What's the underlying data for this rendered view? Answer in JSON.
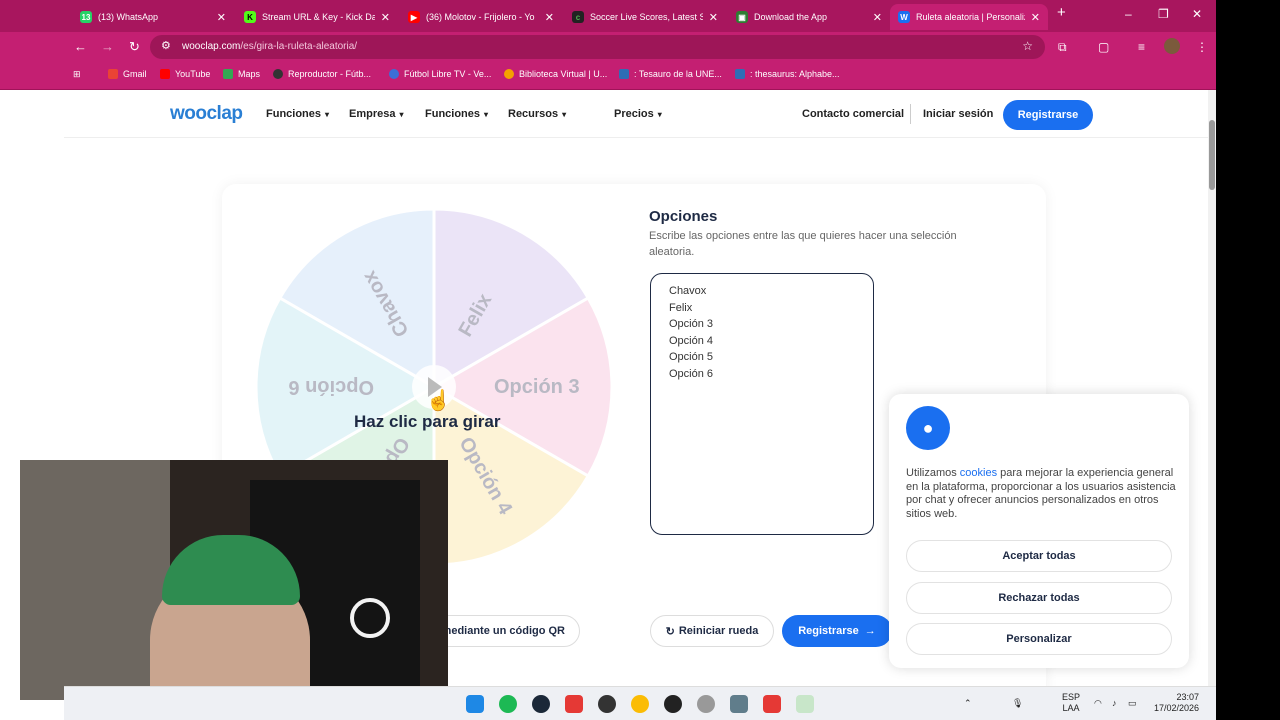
{
  "tabs": [
    {
      "label": "(13) WhatsApp",
      "color": "#25d366",
      "glyph": "13"
    },
    {
      "label": "Stream URL & Key - Kick Da",
      "color": "#53fc18",
      "glyph": "K"
    },
    {
      "label": "(36) Molotov - Frijolero - Yo",
      "color": "#ff0000",
      "glyph": "▶"
    },
    {
      "label": "Soccer Live Scores, Latest S",
      "color": "#222222",
      "glyph": "c"
    },
    {
      "label": "Download the App",
      "color": "#2e7d32",
      "glyph": "▣"
    },
    {
      "label": "Ruleta aleatoria | Personaliz",
      "color": "#1a6ff0",
      "glyph": "W"
    }
  ],
  "window": {
    "new_tab": "+",
    "minimize": "–",
    "maximize": "❐",
    "close": "✕"
  },
  "address": {
    "domain": "wooclap.com",
    "path": "/es/gira-la-ruleta-aleatoria/"
  },
  "bookmarks": [
    {
      "label": "Gmail",
      "color": "#ea4335"
    },
    {
      "label": "YouTube",
      "color": "#ff0000"
    },
    {
      "label": "Maps",
      "color": "#34a853"
    },
    {
      "label": "Reproductor - Fútb...",
      "color": "#333333"
    },
    {
      "label": "Fútbol Libre TV - Ve...",
      "color": "#3b6fd6"
    },
    {
      "label": "Biblioteca Virtual | U...",
      "color": "#f4a100"
    },
    {
      "label": ": Tesauro de la UNE...",
      "color": "#2f6db5"
    },
    {
      "label": ": thesaurus: Alphabe...",
      "color": "#2f6db5"
    }
  ],
  "site": {
    "logo": "wooclap",
    "menu": [
      "Funciones",
      "Empresa",
      "Funciones",
      "Recursos",
      "Precios"
    ],
    "contact": "Contacto comercial",
    "login": "Iniciar sesión",
    "register": "Registrarse"
  },
  "wheel": {
    "labels": [
      "Chavox",
      "Felix",
      "Opción 3",
      "Opción 4",
      "Opción 5",
      "Opción 6"
    ],
    "colors": [
      "#e6f0fb",
      "#ebe4f7",
      "#fbe3ee",
      "#fdf3d6",
      "#e0f4e6",
      "#e3f4f8"
    ],
    "spin_text": "Haz clic para girar"
  },
  "options": {
    "title": "Opciones",
    "description": "Escribe las opciones entre las que quieres hacer una selección aleatoria.",
    "items": [
      "Chavox",
      "Felix",
      "Opción 3",
      "Opción 4",
      "Opción 5",
      "Opción 6"
    ]
  },
  "buttons": {
    "qr": "mediante un código QR",
    "reset": "Reiniciar rueda",
    "register": "Registrarse"
  },
  "cookie": {
    "text_before": "Utilizamos ",
    "link": "cookies",
    "text_after": " para mejorar la experiencia general en la plataforma, proporcionar a los usuarios asistencia por chat y ofrecer anuncios personalizados en otros sitios web.",
    "accept": "Aceptar todas",
    "reject": "Rechazar todas",
    "customize": "Personalizar"
  },
  "taskbar": {
    "lang_top": "ESP",
    "lang_bottom": "LAA",
    "time": "23:07",
    "date": "17/02/2026"
  }
}
